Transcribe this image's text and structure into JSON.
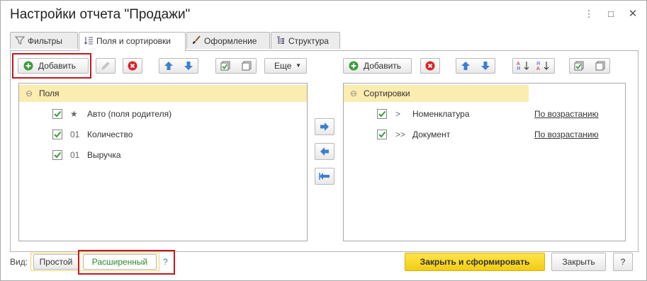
{
  "window": {
    "title": "Настройки отчета \"Продажи\""
  },
  "tabs": [
    {
      "label": "Фильтры",
      "icon": "funnel-icon"
    },
    {
      "label": "Поля и сортировки",
      "icon": "sort-fields-icon"
    },
    {
      "label": "Оформление",
      "icon": "brush-icon"
    },
    {
      "label": "Структура",
      "icon": "structure-icon"
    }
  ],
  "left_toolbar": {
    "add_label": "Добавить",
    "more_label": "Еще"
  },
  "fields": {
    "header": "Поля",
    "items": [
      {
        "prefix": "★",
        "label": "Авто (поля родителя)",
        "checked": true
      },
      {
        "prefix": "01",
        "label": "Количество",
        "checked": true
      },
      {
        "prefix": "01",
        "label": "Выручка",
        "checked": true
      }
    ]
  },
  "right_toolbar": {
    "add_label": "Добавить"
  },
  "sorting": {
    "header": "Сортировки",
    "items": [
      {
        "prefix": ">",
        "label": "Номенклатура",
        "order": "По возрастанию",
        "checked": true
      },
      {
        "prefix": ">>",
        "label": "Документ",
        "order": "По возрастанию",
        "checked": true
      }
    ]
  },
  "footer": {
    "view_label": "Вид:",
    "simple_label": "Простой",
    "extended_label": "Расширенный",
    "help_label": "?",
    "generate_label": "Закрыть и сформировать",
    "close_label": "Закрыть",
    "help2_label": "?"
  },
  "colors": {
    "accent_yellow": "#f5d320",
    "highlight_red": "#c8161d",
    "header_row": "#fbecb0",
    "check_green": "#3a9c3a"
  }
}
